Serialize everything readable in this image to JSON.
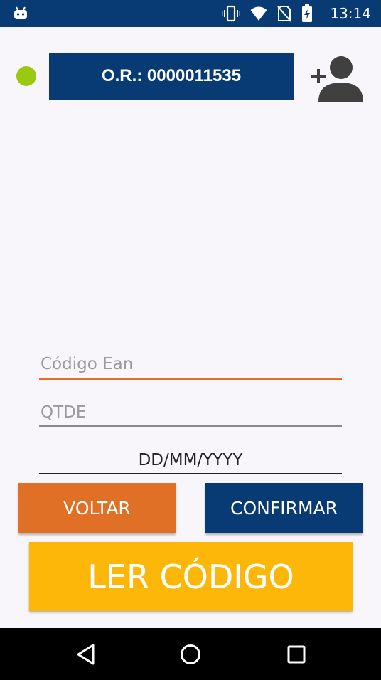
{
  "status_bar": {
    "time": "13:14",
    "icons": [
      "android-icon",
      "vibrate-icon",
      "wifi-icon",
      "no-sim-icon",
      "battery-charging-icon"
    ]
  },
  "header": {
    "status_color": "#9ac90f",
    "order_label": "O.R.: 0000011535",
    "add_user_icon": "add-user-icon"
  },
  "form": {
    "ean": {
      "placeholder": "Código Ean",
      "value": ""
    },
    "qtde": {
      "placeholder": "QTDE",
      "value": ""
    },
    "date": {
      "value": "DD/MM/YYYY"
    }
  },
  "buttons": {
    "back_label": "VOLTAR",
    "confirm_label": "CONFIRMAR",
    "scan_label": "LER CÓDIGO"
  },
  "nav": {
    "icons": [
      "back-icon",
      "home-icon",
      "recent-apps-icon"
    ]
  },
  "colors": {
    "primary": "#083a74",
    "accent_orange": "#e07025",
    "accent_yellow": "#fdb708",
    "status_green": "#9ac90f"
  }
}
